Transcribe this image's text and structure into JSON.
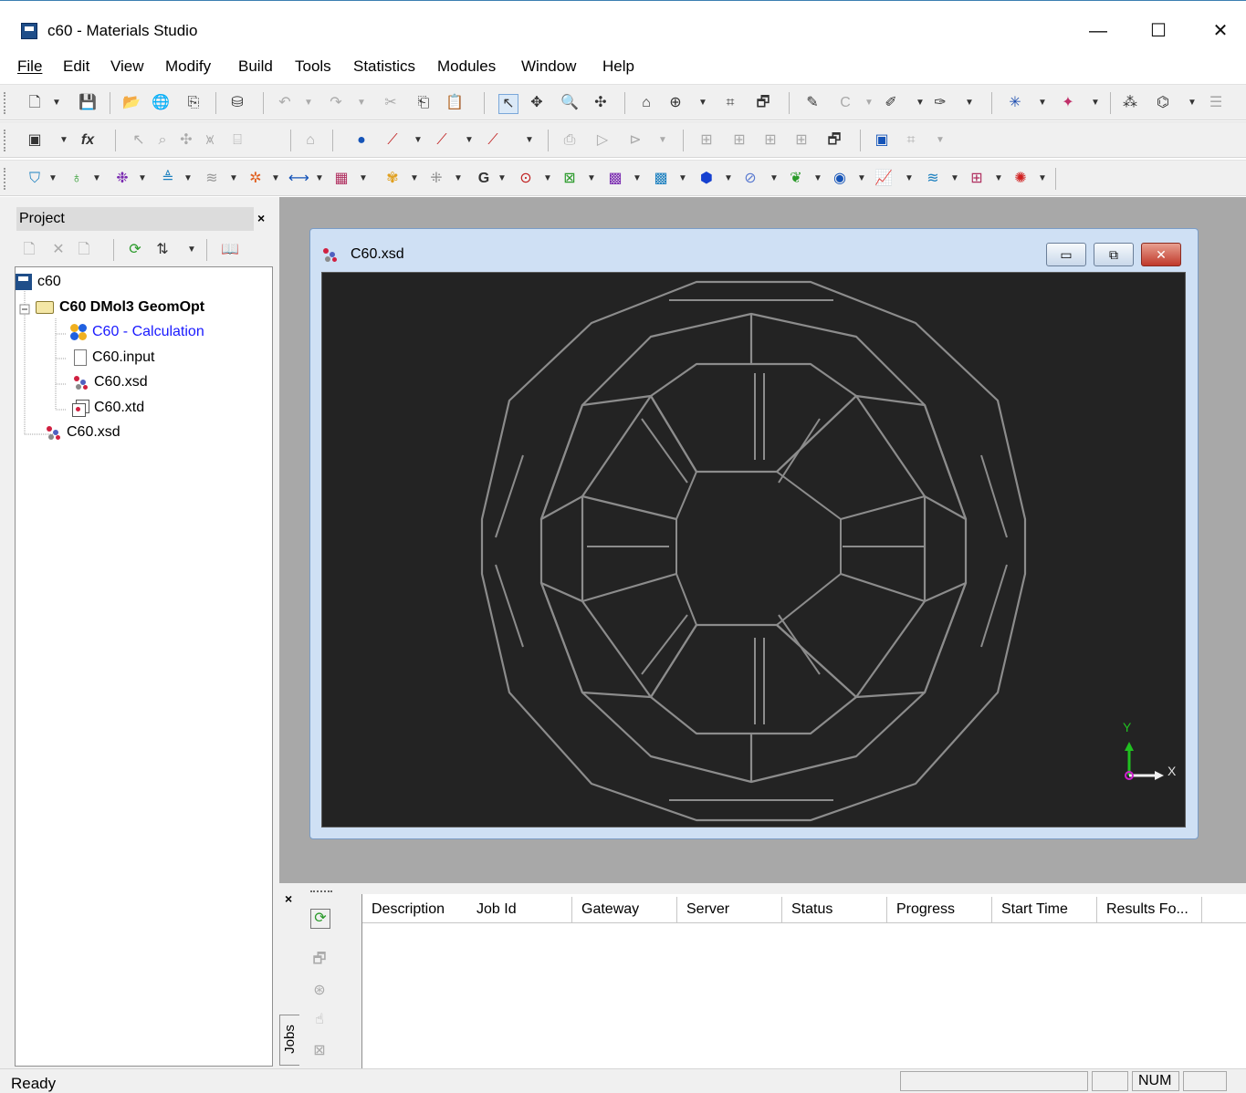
{
  "window": {
    "title": "c60 - Materials Studio",
    "minimize": "—",
    "maximize": "☐",
    "close": "✕"
  },
  "menu": [
    {
      "label": "File",
      "key": "F",
      "rest": "ile"
    },
    {
      "label": "Edit",
      "key": "E",
      "rest": "dit"
    },
    {
      "label": "View",
      "key": "V",
      "rest": "iew"
    },
    {
      "label": "Modify",
      "key": "M",
      "rest": "odify"
    },
    {
      "label": "Build",
      "key": "B",
      "rest": "uild"
    },
    {
      "label": "Tools",
      "key": "T",
      "rest": "ools"
    },
    {
      "label": "Statistics",
      "key": "S",
      "rest": "tatistics"
    },
    {
      "label": "Modules",
      "key": "o",
      "rest": "dules",
      "pre": "M"
    },
    {
      "label": "Window",
      "key": "W",
      "rest": "indow"
    },
    {
      "label": "Help",
      "key": "H",
      "rest": "elp"
    }
  ],
  "project": {
    "header": "Project",
    "close": "×",
    "tree": [
      {
        "label": "c60",
        "icon": "project-icon",
        "bold": false
      },
      {
        "label": "C60 DMol3 GeomOpt",
        "icon": "folder-icon",
        "bold": true
      },
      {
        "label": "C60 - Calculation",
        "icon": "calculation-icon",
        "bold": false,
        "color": "#1a1aff"
      },
      {
        "label": "C60.input",
        "icon": "document-icon",
        "bold": false
      },
      {
        "label": "C60.xsd",
        "icon": "molecule-icon",
        "bold": false
      },
      {
        "label": "C60.xtd",
        "icon": "trajectory-icon",
        "bold": false
      },
      {
        "label": "C60.xsd",
        "icon": "molecule-icon",
        "bold": false
      }
    ]
  },
  "document": {
    "title": "C60.xsd",
    "axes": {
      "y": "Y",
      "x": "X"
    }
  },
  "jobs": {
    "tab_label": "Jobs",
    "close": "×",
    "columns": [
      "Description",
      "Job Id",
      "Gateway",
      "Server",
      "Status",
      "Progress",
      "Start Time",
      "Results Fo..."
    ]
  },
  "status": {
    "text": "Ready",
    "num": "NUM"
  },
  "colors": {
    "workspace": "#a8a8a8",
    "viewer_bg": "#232323",
    "bond": "#8a8a8a",
    "axis_y": "#20c020",
    "axis_origin": "#d020d0",
    "link": "#1a1aff"
  }
}
